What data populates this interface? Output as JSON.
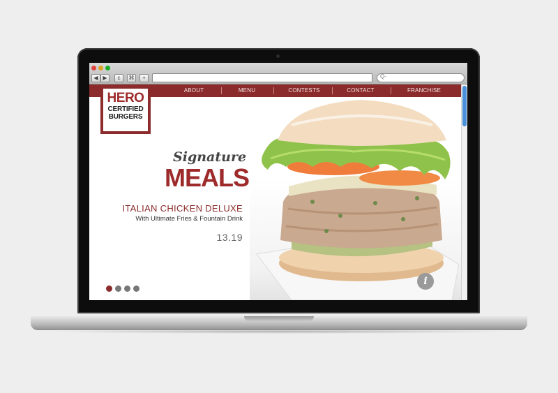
{
  "browser": {
    "nav_back": "◀",
    "nav_forward": "▶",
    "reload": "c",
    "bookmark": "⌘",
    "new_tab": "+",
    "search_icon": "Q-"
  },
  "site_nav": {
    "items": [
      {
        "label": "ABOUT"
      },
      {
        "label": "MENU"
      },
      {
        "label": "CONTESTS"
      },
      {
        "label": "CONTACT"
      },
      {
        "label": "FRANCHISE"
      }
    ]
  },
  "logo": {
    "line1": "HERO",
    "line2": "CERTIFIED",
    "line3": "BURGERS"
  },
  "hero": {
    "signature": "Signature",
    "meals": "MEALS",
    "item_name": "ITALIAN CHICKEN DELUXE",
    "item_sub": "With Ultimate Fries & Fountain Drink",
    "price": "13.19"
  },
  "slider": {
    "dot_count": 4,
    "active_index": 0
  },
  "info_button": "i",
  "colors": {
    "brand_red": "#8b2b2b",
    "hero_red": "#9e2b2b",
    "scroll_blue": "#4a90d9"
  },
  "icons": {
    "info": "info-icon",
    "search": "search-icon"
  }
}
